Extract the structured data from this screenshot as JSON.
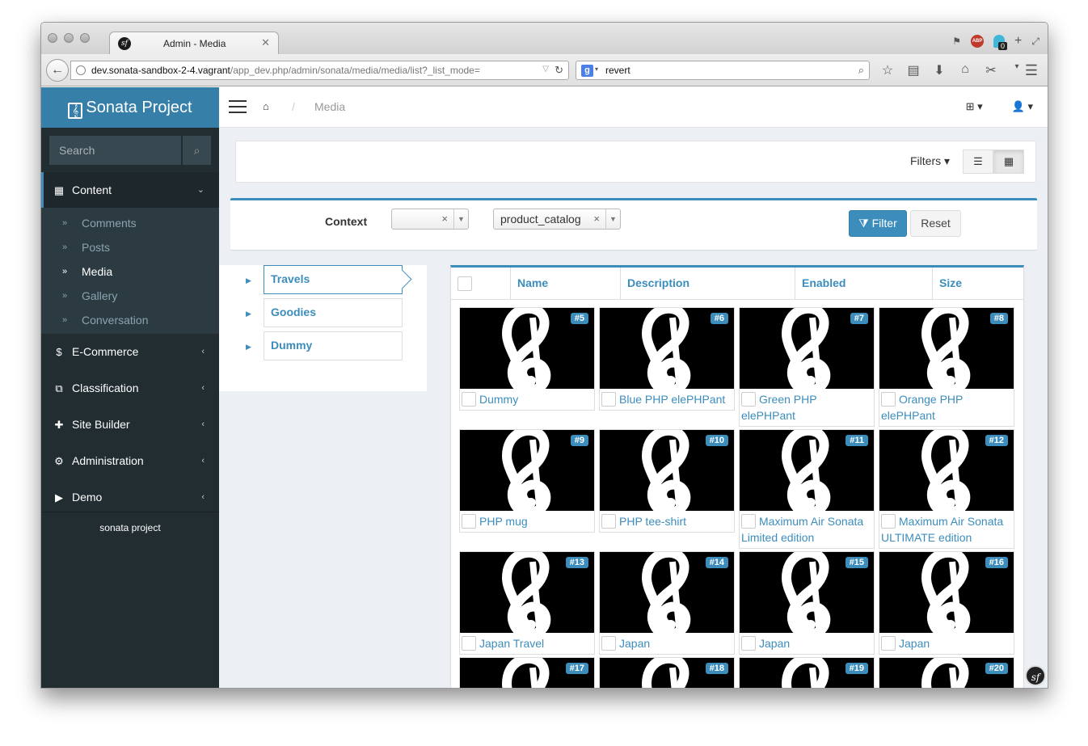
{
  "browser": {
    "tab_title": "Admin - Media",
    "url_host": "dev.sonata-sandbox-2-4.vagrant",
    "url_path": "/app_dev.php/admin/sonata/media/media/list?_list_mode=",
    "search_query": "revert",
    "addon_badge": "0"
  },
  "sidebar": {
    "brand": "Sonata Project",
    "search_placeholder": "Search",
    "menu": [
      {
        "label": "Content",
        "icon": "grid-icon"
      },
      {
        "label": "E-Commerce",
        "icon": "dollar-icon"
      },
      {
        "label": "Classification",
        "icon": "sitemap-icon"
      },
      {
        "label": "Site Builder",
        "icon": "puzzle-icon"
      },
      {
        "label": "Administration",
        "icon": "gears-icon"
      },
      {
        "label": "Demo",
        "icon": "play-circle-icon"
      }
    ],
    "content_items": [
      "Comments",
      "Posts",
      "Media",
      "Gallery",
      "Conversation"
    ],
    "footer": "sonata project"
  },
  "breadcrumb": {
    "current": "Media"
  },
  "list_actions": {
    "filters_label": "Filters"
  },
  "context_filter": {
    "label": "Context",
    "first_value": "",
    "second_value": "product_catalog",
    "filter_button": "Filter",
    "reset_button": "Reset"
  },
  "tree": [
    "Travels",
    "Goodies",
    "Dummy"
  ],
  "table": {
    "columns": [
      "Name",
      "Description",
      "Enabled",
      "Size"
    ]
  },
  "media": [
    {
      "id": "#5",
      "name": "Dummy"
    },
    {
      "id": "#6",
      "name": "Blue PHP elePHPant"
    },
    {
      "id": "#7",
      "name": "Green PHP elePHPant"
    },
    {
      "id": "#8",
      "name": "Orange PHP elePHPant"
    },
    {
      "id": "#9",
      "name": "PHP mug"
    },
    {
      "id": "#10",
      "name": "PHP tee-shirt"
    },
    {
      "id": "#11",
      "name": "Maximum Air Sonata Limited edition"
    },
    {
      "id": "#12",
      "name": "Maximum Air Sonata ULTIMATE edition"
    },
    {
      "id": "#13",
      "name": "Japan Travel"
    },
    {
      "id": "#14",
      "name": "Japan"
    },
    {
      "id": "#15",
      "name": "Japan"
    },
    {
      "id": "#16",
      "name": "Japan"
    },
    {
      "id": "#17",
      "name": ""
    },
    {
      "id": "#18",
      "name": ""
    },
    {
      "id": "#19",
      "name": ""
    },
    {
      "id": "#20",
      "name": ""
    }
  ],
  "colors": {
    "primary": "#3c8dbc",
    "sidebar_bg": "#222d32",
    "brand_bg": "#367fa9"
  }
}
